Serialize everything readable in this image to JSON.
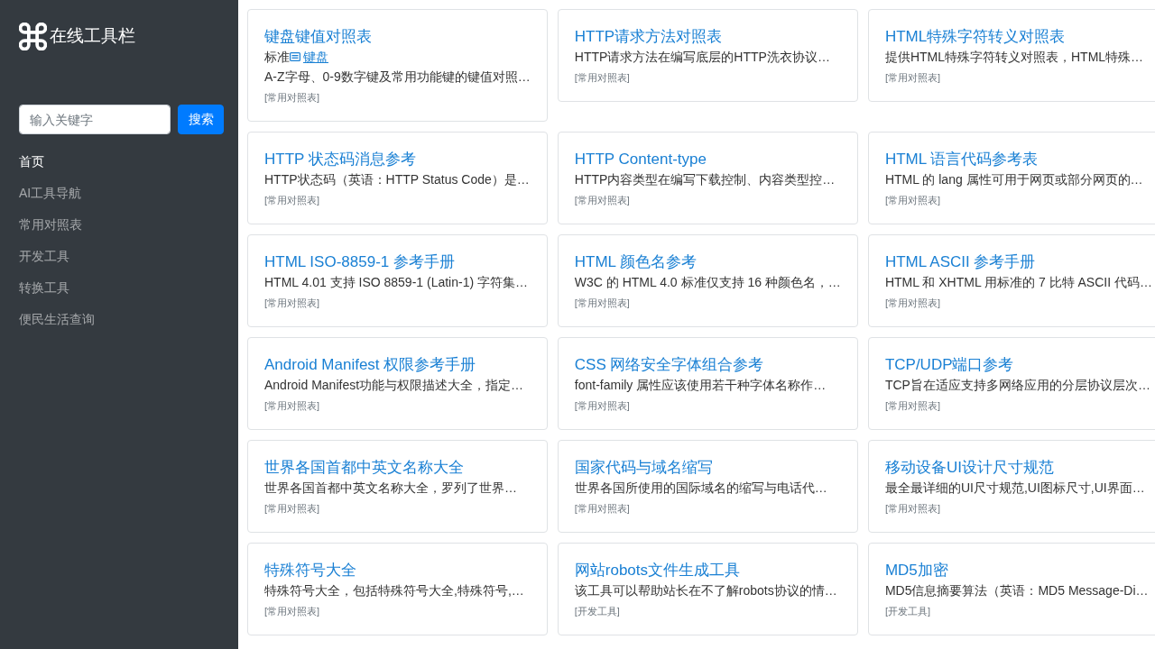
{
  "sidebar": {
    "title": "在线工具栏",
    "search": {
      "placeholder": "输入关键字",
      "button": "搜索"
    },
    "nav": [
      {
        "label": "首页",
        "selected": true
      },
      {
        "label": "AI工具导航",
        "selected": false
      },
      {
        "label": "常用对照表",
        "selected": false
      },
      {
        "label": "开发工具",
        "selected": false
      },
      {
        "label": "转换工具",
        "selected": false
      },
      {
        "label": "便民生活查询",
        "selected": false
      }
    ]
  },
  "cards": [
    {
      "title": "键盘键值对照表",
      "note": {
        "text": "标准",
        "link": "键盘"
      },
      "description": "A-Z字母、0-9数字键及常用功能键的键值对照…",
      "tag": "[常用对照表]"
    },
    {
      "title": "HTTP请求方法对照表",
      "description": "HTTP请求方法在编写底层的HTTP洗衣协议…",
      "tag": "[常用对照表]"
    },
    {
      "title": "HTML特殊字符转义对照表",
      "description": "提供HTML特殊字符转义对照表，HTML特殊…",
      "tag": "[常用对照表]"
    },
    {
      "title": "HTTP 状态码消息参考",
      "description": "HTTP状态码（英语：HTTP Status Code）是…",
      "tag": "[常用对照表]"
    },
    {
      "title": "HTTP Content-type",
      "description": "HTTP内容类型在编写下载控制、内容类型控…",
      "tag": "[常用对照表]"
    },
    {
      "title": "HTML 语言代码参考表",
      "description": "HTML 的 lang 属性可用于网页或部分网页的…",
      "tag": "[常用对照表]"
    },
    {
      "title": "HTML ISO-8859-1 参考手册",
      "description": "HTML 4.01 支持 ISO 8859-1 (Latin-1) 字符集…",
      "tag": "[常用对照表]"
    },
    {
      "title": "HTML 颜色名参考",
      "description": "W3C 的 HTML 4.0 标准仅支持 16 种颜色名，…",
      "tag": "[常用对照表]"
    },
    {
      "title": "HTML ASCII 参考手册",
      "description": "HTML 和 XHTML 用标准的 7 比特 ASCII 代码…",
      "tag": "[常用对照表]"
    },
    {
      "title": "Android Manifest 权限参考手册",
      "description": "Android Manifest功能与权限描述大全，指定…",
      "tag": "[常用对照表]"
    },
    {
      "title": "CSS 网络安全字体组合参考",
      "description": "font-family 属性应该使用若干种字体名称作…",
      "tag": "[常用对照表]"
    },
    {
      "title": "TCP/UDP端口参考",
      "description": "TCP旨在适应支持多网络应用的分层协议层次…",
      "tag": "[常用对照表]"
    },
    {
      "title": "世界各国首都中英文名称大全",
      "description": "世界各国首都中英文名称大全，罗列了世界…",
      "tag": "[常用对照表]"
    },
    {
      "title": "国家代码与域名缩写",
      "description": "世界各国所使用的国际域名的缩写与电话代…",
      "tag": "[常用对照表]"
    },
    {
      "title": "移动设备UI设计尺寸规范",
      "description": "最全最详细的UI尺寸规范,UI图标尺寸,UI界面…",
      "tag": "[常用对照表]"
    },
    {
      "title": "特殊符号大全",
      "description": "特殊符号大全，包括特殊符号大全,特殊符号,…",
      "tag": "[常用对照表]"
    },
    {
      "title": "网站robots文件生成工具",
      "description": "该工具可以帮助站长在不了解robots协议的情…",
      "tag": "[开发工具]"
    },
    {
      "title": "MD5加密",
      "description": "MD5信息摘要算法（英语：MD5 Message-Di…",
      "tag": "[开发工具]"
    }
  ]
}
